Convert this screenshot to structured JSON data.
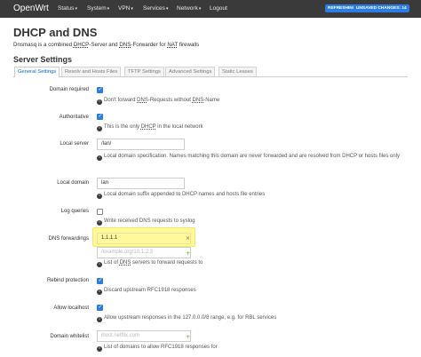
{
  "nav": {
    "brand": "OpenWrt",
    "items": [
      {
        "label": "Status",
        "caret": "▾"
      },
      {
        "label": "System",
        "caret": "▾"
      },
      {
        "label": "VPN",
        "caret": "▾"
      },
      {
        "label": "Services",
        "caret": "▾"
      },
      {
        "label": "Network",
        "caret": "▾"
      },
      {
        "label": "Logout",
        "caret": ""
      }
    ],
    "badges": [
      {
        "label": "REFRESHING",
        "color": "#2a7de1"
      },
      {
        "label": "UNSAVED CHANGES: 14",
        "color": "#2a7de1"
      }
    ]
  },
  "page": {
    "title": "DHCP and DNS",
    "description_parts": [
      "Dnsmasq is a combined ",
      "DHCP",
      "-Server and ",
      "DNS",
      "-Forwarder for ",
      "NAT",
      " firewalls"
    ],
    "section_title": "Server Settings"
  },
  "tabs": [
    {
      "label": "General Settings",
      "active": true
    },
    {
      "label": "Resolv and Hosts Files",
      "active": false
    },
    {
      "label": "TFTP Settings",
      "active": false
    },
    {
      "label": "Advanced Settings",
      "active": false
    },
    {
      "label": "Static Leases",
      "active": false
    }
  ],
  "fields": {
    "domain_required": {
      "label": "Domain required",
      "checked": true,
      "hint_parts": [
        "Don't forward ",
        "DNS",
        "-Requests without ",
        "DNS",
        "-Name"
      ]
    },
    "authoritative": {
      "label": "Authoritative",
      "checked": true,
      "hint_parts": [
        "This is the only ",
        "DHCP",
        " in the local network"
      ]
    },
    "local_server": {
      "label": "Local server",
      "value": "/lan/",
      "hint": "Local domain specification. Names matching this domain are never forwarded and are resolved from DHCP or hosts files only"
    },
    "local_domain": {
      "label": "Local domain",
      "value": "lan",
      "hint": "Local domain suffix appended to DHCP names and hosts file entries"
    },
    "log_queries": {
      "label": "Log queries",
      "checked": false,
      "hint": "Write received DNS requests to syslog"
    },
    "dns_forwardings": {
      "label": "DNS forwardings",
      "value": "1.1.1.1",
      "placeholder": "/example.org/10.1.2.3",
      "hint_parts": [
        "List of ",
        "DNS",
        " servers to forward requests to"
      ],
      "remove_symbol": "×",
      "add_symbol": "+"
    },
    "rebind_protection": {
      "label": "Rebind protection",
      "checked": true,
      "hint": "Discard upstream RFC1918 responses"
    },
    "allow_localhost": {
      "label": "Allow localhost",
      "checked": true,
      "hint": "Allow upstream responses in the 127.0.0.0/8 range, e.g. for RBL services"
    },
    "domain_whitelist": {
      "label": "Domain whitelist",
      "placeholder": "ihost.netflix.com",
      "hint": "List of domains to allow RFC1918 responses for",
      "add_symbol": "+"
    }
  },
  "hint_icon": "info-icon",
  "hint_icon_glyph": "i"
}
